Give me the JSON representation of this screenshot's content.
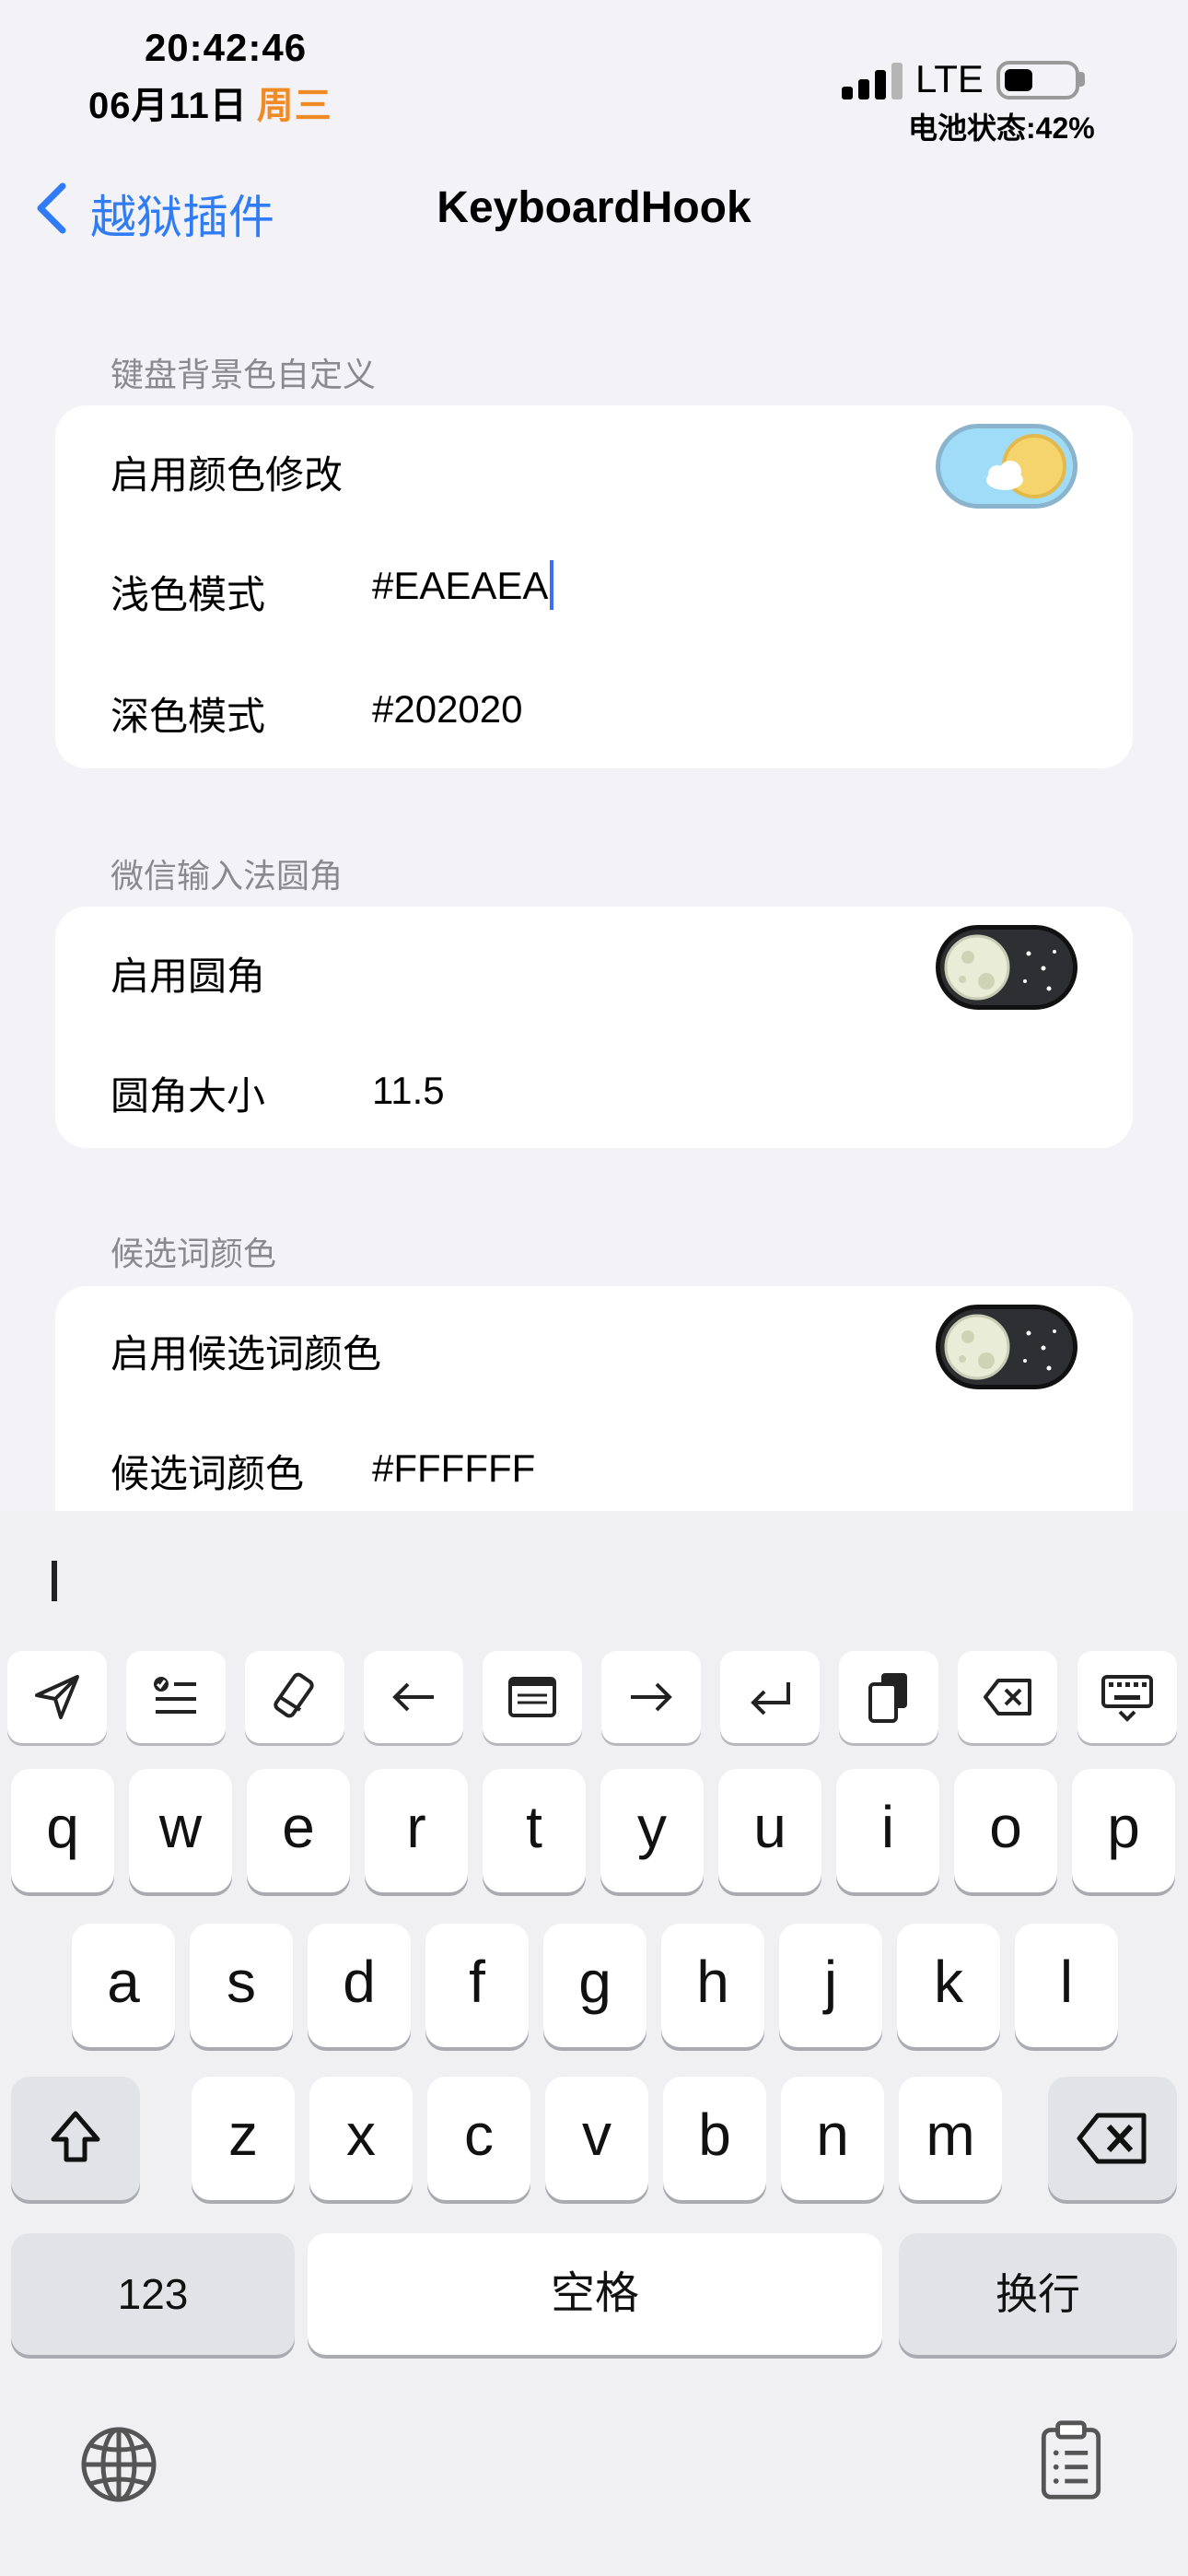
{
  "status_bar": {
    "time": "20:42:46",
    "date": "06月11日",
    "weekday": "周三",
    "network": "LTE",
    "battery_text": "电池状态:42%",
    "battery_level": 0.42
  },
  "nav": {
    "back_label": "越狱插件",
    "title": "KeyboardHook"
  },
  "sections": [
    {
      "header": "键盘背景色自定义",
      "rows": [
        {
          "label": "启用颜色修改",
          "toggle": "on"
        },
        {
          "label": "浅色模式",
          "value": "#EAEAEA"
        },
        {
          "label": "深色模式",
          "value": "#202020"
        }
      ]
    },
    {
      "header": "微信输入法圆角",
      "rows": [
        {
          "label": "启用圆角",
          "toggle": "off"
        },
        {
          "label": "圆角大小",
          "value": "11.5"
        }
      ]
    },
    {
      "header": "候选词颜色",
      "rows": [
        {
          "label": "启用候选词颜色",
          "toggle": "off"
        },
        {
          "label": "候选词颜色",
          "value": "#FFFFFF"
        }
      ]
    }
  ],
  "keyboard": {
    "toolbar_icons": [
      "send-icon",
      "checklist-icon",
      "eraser-icon",
      "arrow-left-icon",
      "text-box-icon",
      "arrow-right-icon",
      "return-icon",
      "copy-icon",
      "delete-icon",
      "keyboard-hide-icon"
    ],
    "row1": [
      "q",
      "w",
      "e",
      "r",
      "t",
      "y",
      "u",
      "i",
      "o",
      "p"
    ],
    "row2": [
      "a",
      "s",
      "d",
      "f",
      "g",
      "h",
      "j",
      "k",
      "l"
    ],
    "row3": [
      "z",
      "x",
      "c",
      "v",
      "b",
      "n",
      "m"
    ],
    "numbers_label": "123",
    "space_label": "空格",
    "return_label": "换行"
  },
  "colors": {
    "accent": "#2f7cf6",
    "weekday": "#f08a24",
    "caret": "#3b6ff5"
  }
}
